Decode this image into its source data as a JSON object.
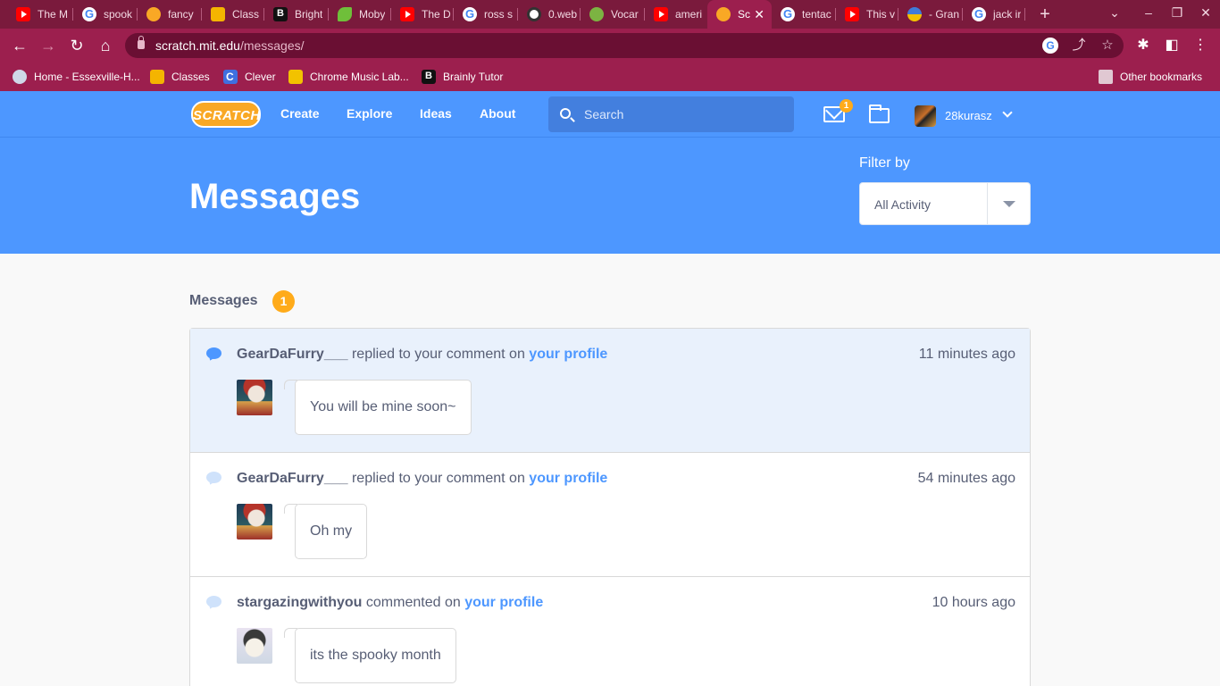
{
  "browser": {
    "tabs": [
      {
        "title": "The M",
        "icon": "youtube-icon"
      },
      {
        "title": "spook",
        "icon": "google-icon"
      },
      {
        "title": "fancy",
        "icon": "scratch-icon"
      },
      {
        "title": "Class",
        "icon": "classroom-icon"
      },
      {
        "title": "Bright",
        "icon": "brainly-icon"
      },
      {
        "title": "Moby",
        "icon": "leaf-icon"
      },
      {
        "title": "The D",
        "icon": "youtube-icon"
      },
      {
        "title": "ross s",
        "icon": "google-icon"
      },
      {
        "title": "0.web",
        "icon": "globe-icon"
      },
      {
        "title": "Vocar",
        "icon": "vocaroo-icon"
      },
      {
        "title": "ameri",
        "icon": "youtube-icon"
      },
      {
        "title": "Sc",
        "icon": "scratch-icon",
        "active": true
      },
      {
        "title": "tentac",
        "icon": "google-icon"
      },
      {
        "title": "This v",
        "icon": "youtube-icon"
      },
      {
        "title": "- Gran",
        "icon": "grammarly-icon"
      },
      {
        "title": "jack ir",
        "icon": "google-icon"
      }
    ],
    "url_host": "scratch.mit.edu",
    "url_path": "/messages/",
    "bookmarks": [
      {
        "label": "Home - Essexville-H...",
        "icon": "home-icon"
      },
      {
        "label": "Classes",
        "icon": "classroom-icon"
      },
      {
        "label": "Clever",
        "icon": "clever-icon"
      },
      {
        "label": "Chrome Music Lab...",
        "icon": "music-lab-icon"
      },
      {
        "label": "Brainly Tutor",
        "icon": "brainly-icon"
      }
    ],
    "other_bookmarks": "Other bookmarks"
  },
  "scratch_nav": {
    "logo_text": "SCRATCH",
    "links": [
      "Create",
      "Explore",
      "Ideas",
      "About"
    ],
    "search_placeholder": "Search",
    "message_count": "1",
    "username": "28kurasz"
  },
  "banner": {
    "title": "Messages",
    "filter_label": "Filter by",
    "filter_value": "All Activity"
  },
  "messages_section": {
    "title": "Messages",
    "count": "1",
    "items": [
      {
        "user": "GearDaFurry___",
        "action": "replied to your comment on",
        "target": "your profile",
        "time": "11 minutes ago",
        "comment": "You will be mine soon~",
        "unread": true
      },
      {
        "user": "GearDaFurry___",
        "action": "replied to your comment on",
        "target": "your profile",
        "time": "54 minutes ago",
        "comment": "Oh my",
        "unread": false
      },
      {
        "user": "stargazingwithyou",
        "action": "commented on",
        "target": "your profile",
        "time": "10 hours ago",
        "comment": "its the spooky month",
        "unread": false
      }
    ]
  },
  "colors": {
    "chrome_theme": "#9c1f4e",
    "scratch_blue": "#4d97ff",
    "badge_orange": "#ffab1a",
    "unread_bg": "#e9f1fc"
  }
}
